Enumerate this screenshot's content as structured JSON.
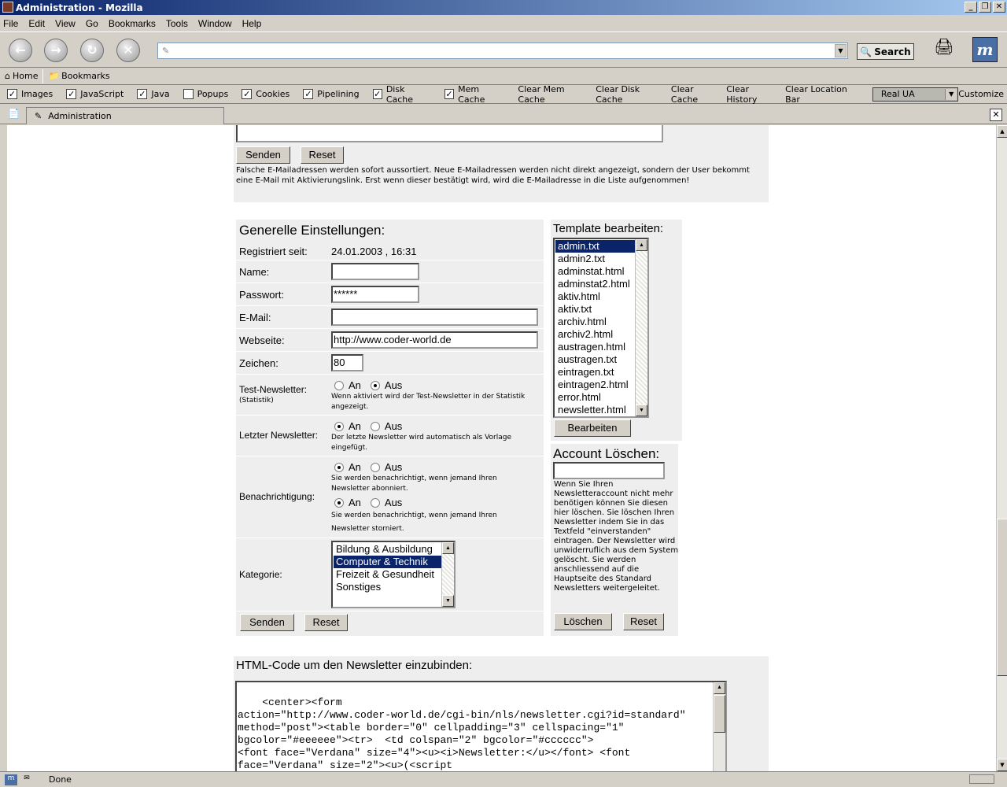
{
  "window": {
    "title": "Administration - Mozilla",
    "controls": [
      "_",
      "❐",
      "✕"
    ]
  },
  "menu": [
    "File",
    "Edit",
    "View",
    "Go",
    "Bookmarks",
    "Tools",
    "Window",
    "Help"
  ],
  "nav": {
    "back_icon": "back-arrow-icon",
    "forward_icon": "forward-arrow-icon",
    "reload_icon": "reload-icon",
    "stop_icon": "stop-icon",
    "url_value": "",
    "search_label": "Search"
  },
  "bookmarks_bar": {
    "home": "Home",
    "bookmarks": "Bookmarks"
  },
  "prefbar": {
    "checks": [
      {
        "label": "Images",
        "checked": "✓"
      },
      {
        "label": "JavaScript",
        "checked": "✓"
      },
      {
        "label": "Java",
        "checked": "✓"
      },
      {
        "label": "Popups",
        "checked": ""
      },
      {
        "label": "Cookies",
        "checked": "✓"
      },
      {
        "label": "Pipelining",
        "checked": "✓"
      },
      {
        "label": "Disk Cache",
        "checked": "✓"
      },
      {
        "label": "Mem Cache",
        "checked": "✓"
      }
    ],
    "buttons": [
      "Clear Mem Cache",
      "Clear Disk Cache",
      "Clear Cache",
      "Clear History",
      "Clear Location Bar"
    ],
    "ua_select": "Real UA",
    "customize": "Customize"
  },
  "tab": {
    "title": "Administration"
  },
  "top_form": {
    "send": "Senden",
    "reset": "Reset",
    "note": "Falsche E-Mailadressen werden sofort aussortiert. Neue E-Mailadressen werden nicht direkt angezeigt, sondern der User bekommt eine E-Mail mit Aktivierungslink. Erst wenn dieser bestätigt wird, wird die E-Mailadresse in die Liste aufgenommen!"
  },
  "general": {
    "title": "Generelle Einstellungen:",
    "registered_label": "Registriert seit:",
    "registered_value": "24.01.2003 , 16:31",
    "name_label": "Name:",
    "name_value": "",
    "password_label": "Passwort:",
    "password_value": "******",
    "email_label": "E-Mail:",
    "email_value": "",
    "website_label": "Webseite:",
    "website_value": "http://www.coder-world.de",
    "chars_label": "Zeichen:",
    "chars_value": "80",
    "test_label": "Test-Newsletter:",
    "test_sub": "(Statistik)",
    "test_note": "Wenn aktiviert wird der Test-Newsletter in der Statistik angezeigt.",
    "last_label": "Letzter Newsletter:",
    "last_note": "Der letzte Newsletter wird automatisch als Vorlage eingefügt.",
    "notify_label": "Benachrichtigung:",
    "notify_note1": "Sie werden benachrichtigt, wenn jemand Ihren Newsletter abonniert.",
    "notify_note2": "Sie werden benachrichtigt, wenn jemand Ihren Newsletter storniert.",
    "on": "An",
    "off": "Aus",
    "category_label": "Kategorie:",
    "categories": [
      "Bildung & Ausbildung",
      "Computer & Technik",
      "Freizeit & Gesundheit",
      "Sonstiges"
    ],
    "category_selected": "Computer & Technik",
    "send": "Senden",
    "reset": "Reset"
  },
  "template": {
    "title": "Template bearbeiten:",
    "files": [
      "admin.txt",
      "admin2.txt",
      "adminstat.html",
      "adminstat2.html",
      "aktiv.html",
      "aktiv.txt",
      "archiv.html",
      "archiv2.html",
      "austragen.html",
      "austragen.txt",
      "eintragen.txt",
      "eintragen2.html",
      "error.html",
      "newsletter.html"
    ],
    "selected": "admin.txt",
    "edit": "Bearbeiten"
  },
  "account": {
    "title": "Account Löschen:",
    "input_value": "",
    "note": "Wenn Sie Ihren Newsletteraccount nicht mehr benötigen können Sie diesen hier löschen. Sie löschen Ihren Newsletter indem Sie in das Textfeld \"einverstanden\" eintragen. Der Newsletter wird unwiderruflich aus dem System gelöscht. Sie werden anschliessend auf die Hauptseite des Standard Newsletters weitergeleitet.",
    "delete": "Löschen",
    "reset": "Reset"
  },
  "html_code": {
    "title": "HTML-Code um den Newsletter einzubinden:",
    "code": "<center><form\naction=\"http://www.coder-world.de/cgi-bin/nls/newsletter.cgi?id=standard\"\nmethod=\"post\"><table border=\"0\" cellpadding=\"3\" cellspacing=\"1\"\nbgcolor=\"#eeeeee\"><tr>  <td colspan=\"2\" bgcolor=\"#cccccc\">\n<font face=\"Verdana\" size=\"4\"><u><i>Newsletter:</u></font> <font\nface=\"Verdana\" size=\"2\"><u>(<script\nsrc=\"http://www.coder-world.de/cgi-bin/nls/newsletter.cgi?id=standard&action"
  },
  "status": {
    "text": "Done"
  },
  "colors": {
    "title_gradient_start": "#0a246a",
    "selection": "#0a246a",
    "panel_bg": "#eeeeee",
    "chrome": "#d4d0c8"
  }
}
